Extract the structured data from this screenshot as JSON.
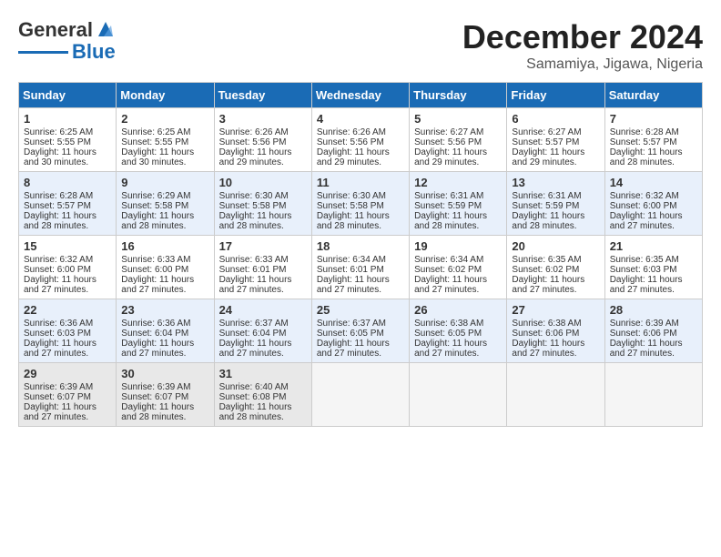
{
  "header": {
    "logo_line1": "General",
    "logo_line2": "Blue",
    "title": "December 2024",
    "subtitle": "Samamiya, Jigawa, Nigeria"
  },
  "weekdays": [
    "Sunday",
    "Monday",
    "Tuesday",
    "Wednesday",
    "Thursday",
    "Friday",
    "Saturday"
  ],
  "weeks": [
    [
      {
        "day": "1",
        "lines": [
          "Sunrise: 6:25 AM",
          "Sunset: 5:55 PM",
          "Daylight: 11 hours",
          "and 30 minutes."
        ]
      },
      {
        "day": "2",
        "lines": [
          "Sunrise: 6:25 AM",
          "Sunset: 5:55 PM",
          "Daylight: 11 hours",
          "and 30 minutes."
        ]
      },
      {
        "day": "3",
        "lines": [
          "Sunrise: 6:26 AM",
          "Sunset: 5:56 PM",
          "Daylight: 11 hours",
          "and 29 minutes."
        ]
      },
      {
        "day": "4",
        "lines": [
          "Sunrise: 6:26 AM",
          "Sunset: 5:56 PM",
          "Daylight: 11 hours",
          "and 29 minutes."
        ]
      },
      {
        "day": "5",
        "lines": [
          "Sunrise: 6:27 AM",
          "Sunset: 5:56 PM",
          "Daylight: 11 hours",
          "and 29 minutes."
        ]
      },
      {
        "day": "6",
        "lines": [
          "Sunrise: 6:27 AM",
          "Sunset: 5:57 PM",
          "Daylight: 11 hours",
          "and 29 minutes."
        ]
      },
      {
        "day": "7",
        "lines": [
          "Sunrise: 6:28 AM",
          "Sunset: 5:57 PM",
          "Daylight: 11 hours",
          "and 28 minutes."
        ]
      }
    ],
    [
      {
        "day": "8",
        "lines": [
          "Sunrise: 6:28 AM",
          "Sunset: 5:57 PM",
          "Daylight: 11 hours",
          "and 28 minutes."
        ]
      },
      {
        "day": "9",
        "lines": [
          "Sunrise: 6:29 AM",
          "Sunset: 5:58 PM",
          "Daylight: 11 hours",
          "and 28 minutes."
        ]
      },
      {
        "day": "10",
        "lines": [
          "Sunrise: 6:30 AM",
          "Sunset: 5:58 PM",
          "Daylight: 11 hours",
          "and 28 minutes."
        ]
      },
      {
        "day": "11",
        "lines": [
          "Sunrise: 6:30 AM",
          "Sunset: 5:58 PM",
          "Daylight: 11 hours",
          "and 28 minutes."
        ]
      },
      {
        "day": "12",
        "lines": [
          "Sunrise: 6:31 AM",
          "Sunset: 5:59 PM",
          "Daylight: 11 hours",
          "and 28 minutes."
        ]
      },
      {
        "day": "13",
        "lines": [
          "Sunrise: 6:31 AM",
          "Sunset: 5:59 PM",
          "Daylight: 11 hours",
          "and 28 minutes."
        ]
      },
      {
        "day": "14",
        "lines": [
          "Sunrise: 6:32 AM",
          "Sunset: 6:00 PM",
          "Daylight: 11 hours",
          "and 27 minutes."
        ]
      }
    ],
    [
      {
        "day": "15",
        "lines": [
          "Sunrise: 6:32 AM",
          "Sunset: 6:00 PM",
          "Daylight: 11 hours",
          "and 27 minutes."
        ]
      },
      {
        "day": "16",
        "lines": [
          "Sunrise: 6:33 AM",
          "Sunset: 6:00 PM",
          "Daylight: 11 hours",
          "and 27 minutes."
        ]
      },
      {
        "day": "17",
        "lines": [
          "Sunrise: 6:33 AM",
          "Sunset: 6:01 PM",
          "Daylight: 11 hours",
          "and 27 minutes."
        ]
      },
      {
        "day": "18",
        "lines": [
          "Sunrise: 6:34 AM",
          "Sunset: 6:01 PM",
          "Daylight: 11 hours",
          "and 27 minutes."
        ]
      },
      {
        "day": "19",
        "lines": [
          "Sunrise: 6:34 AM",
          "Sunset: 6:02 PM",
          "Daylight: 11 hours",
          "and 27 minutes."
        ]
      },
      {
        "day": "20",
        "lines": [
          "Sunrise: 6:35 AM",
          "Sunset: 6:02 PM",
          "Daylight: 11 hours",
          "and 27 minutes."
        ]
      },
      {
        "day": "21",
        "lines": [
          "Sunrise: 6:35 AM",
          "Sunset: 6:03 PM",
          "Daylight: 11 hours",
          "and 27 minutes."
        ]
      }
    ],
    [
      {
        "day": "22",
        "lines": [
          "Sunrise: 6:36 AM",
          "Sunset: 6:03 PM",
          "Daylight: 11 hours",
          "and 27 minutes."
        ]
      },
      {
        "day": "23",
        "lines": [
          "Sunrise: 6:36 AM",
          "Sunset: 6:04 PM",
          "Daylight: 11 hours",
          "and 27 minutes."
        ]
      },
      {
        "day": "24",
        "lines": [
          "Sunrise: 6:37 AM",
          "Sunset: 6:04 PM",
          "Daylight: 11 hours",
          "and 27 minutes."
        ]
      },
      {
        "day": "25",
        "lines": [
          "Sunrise: 6:37 AM",
          "Sunset: 6:05 PM",
          "Daylight: 11 hours",
          "and 27 minutes."
        ]
      },
      {
        "day": "26",
        "lines": [
          "Sunrise: 6:38 AM",
          "Sunset: 6:05 PM",
          "Daylight: 11 hours",
          "and 27 minutes."
        ]
      },
      {
        "day": "27",
        "lines": [
          "Sunrise: 6:38 AM",
          "Sunset: 6:06 PM",
          "Daylight: 11 hours",
          "and 27 minutes."
        ]
      },
      {
        "day": "28",
        "lines": [
          "Sunrise: 6:39 AM",
          "Sunset: 6:06 PM",
          "Daylight: 11 hours",
          "and 27 minutes."
        ]
      }
    ],
    [
      {
        "day": "29",
        "lines": [
          "Sunrise: 6:39 AM",
          "Sunset: 6:07 PM",
          "Daylight: 11 hours",
          "and 27 minutes."
        ]
      },
      {
        "day": "30",
        "lines": [
          "Sunrise: 6:39 AM",
          "Sunset: 6:07 PM",
          "Daylight: 11 hours",
          "and 28 minutes."
        ]
      },
      {
        "day": "31",
        "lines": [
          "Sunrise: 6:40 AM",
          "Sunset: 6:08 PM",
          "Daylight: 11 hours",
          "and 28 minutes."
        ]
      },
      {
        "day": "",
        "lines": []
      },
      {
        "day": "",
        "lines": []
      },
      {
        "day": "",
        "lines": []
      },
      {
        "day": "",
        "lines": []
      }
    ]
  ]
}
